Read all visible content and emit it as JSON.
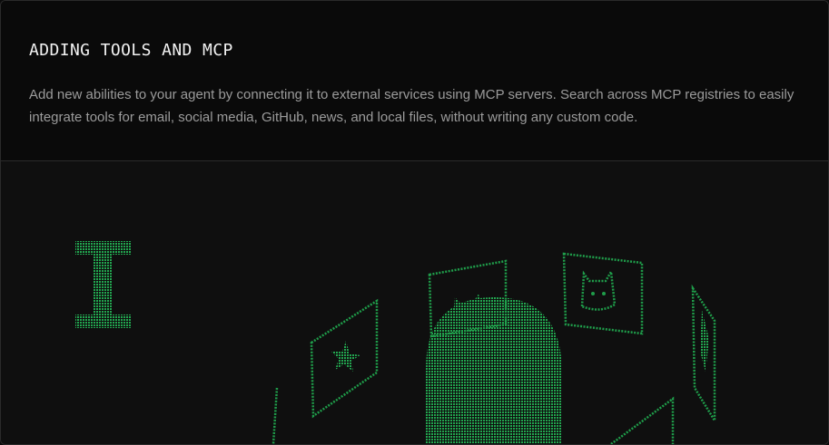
{
  "section": {
    "title": "ADDING TOOLS AND MCP",
    "description": "Add new abilities to your agent by connecting it to external services using MCP servers. Search across MCP registries to easily integrate tools for email, social media, GitHub, news, and local files, without writing any custom code."
  },
  "illustration": {
    "accent_color": "#1f9d4a",
    "accent_dim": "#167a38",
    "icons": [
      "text-cursor-icon",
      "robot-head-icon",
      "star-card-icon",
      "cat-card-icon",
      "llama-card-icon",
      "feather-card-icon"
    ]
  }
}
